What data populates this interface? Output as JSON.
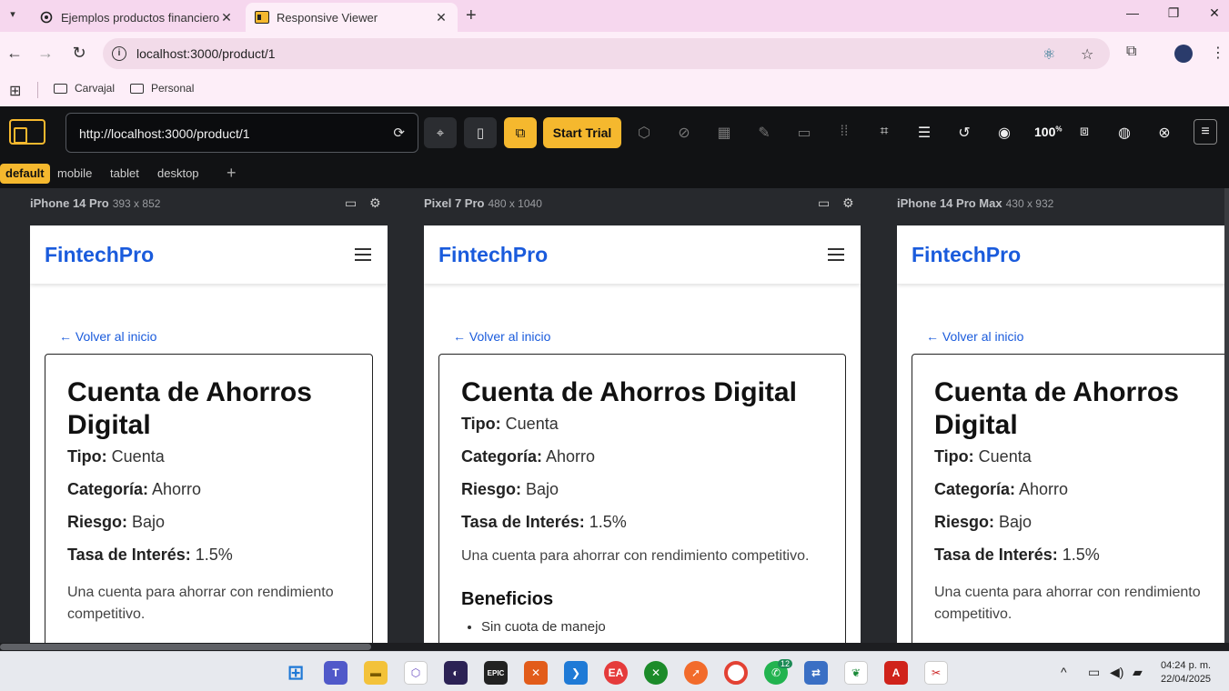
{
  "browser": {
    "tabs": [
      {
        "title": "Ejemplos productos financieros",
        "active": false
      },
      {
        "title": "Responsive Viewer",
        "active": true
      }
    ],
    "url": "localhost:3000/product/1",
    "bookmarks": [
      "Carvajal",
      "Personal"
    ]
  },
  "viewer": {
    "url": "http://localhost:3000/product/1",
    "start_trial": "Start Trial",
    "zoom": "100",
    "zoom_unit": "%",
    "presets": [
      "default",
      "mobile",
      "tablet",
      "desktop"
    ],
    "add_preset": "+"
  },
  "devices": [
    {
      "name": "iPhone 14 Pro",
      "dims": "393 x 852"
    },
    {
      "name": "Pixel 7 Pro",
      "dims": "480 x 1040"
    },
    {
      "name": "iPhone 14 Pro Max",
      "dims": "430 x 932"
    }
  ],
  "page": {
    "brand": "FintechPro",
    "back_link": "← Volver al inicio",
    "product_title": "Cuenta de Ahorros Digital",
    "fields": [
      {
        "label": "Tipo:",
        "value": "Cuenta"
      },
      {
        "label": "Categoría:",
        "value": "Ahorro"
      },
      {
        "label": "Riesgo:",
        "value": "Bajo"
      },
      {
        "label": "Tasa de Interés:",
        "value": "1.5%"
      }
    ],
    "description": "Una cuenta para ahorrar con rendimiento competitivo.",
    "benefits_heading": "Beneficios",
    "benefits": [
      "Sin cuota de manejo"
    ]
  },
  "taskbar": {
    "time": "04:24 p. m.",
    "date": "22/04/2025",
    "whatsapp_badge": "12"
  }
}
